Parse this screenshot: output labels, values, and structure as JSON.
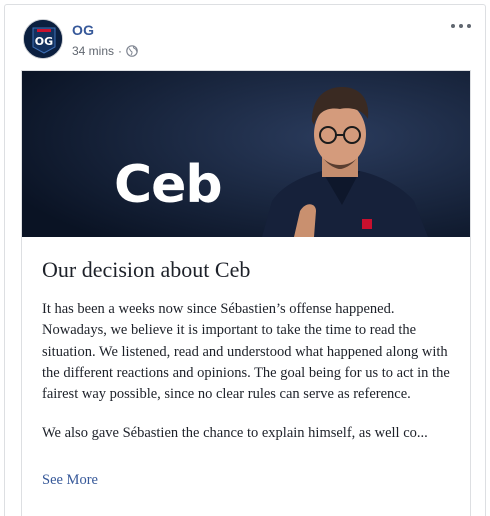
{
  "post": {
    "page_name": "OG",
    "timestamp": "34 mins",
    "separator": "·",
    "privacy_icon": "globe-icon",
    "more_icon": "more-options-icon",
    "avatar_logo": "OG"
  },
  "article": {
    "banner_text": "Ceb",
    "headline": "Our decision about Ceb",
    "paragraphs": [
      "It has been a weeks now since Sébastien’s offense happened. Nowadays, we believe it is important to take the time to read the situation. We listened, read and understood what happened along with the different reactions and opinions. The goal being for us to act in the fairest way possible, since no clear rules can serve as reference.",
      "We also gave Sébastien the chance to explain himself, as well co..."
    ],
    "see_more": "See More"
  },
  "colors": {
    "link": "#365899",
    "text": "#1d2129",
    "meta": "#616770",
    "banner_bg": "#0f1a2e"
  }
}
